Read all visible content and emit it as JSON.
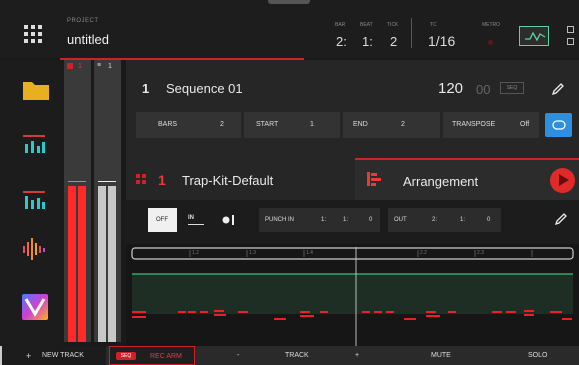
{
  "header": {
    "project_label": "PROJECT",
    "project_name": "untitled",
    "bar_label": "BAR",
    "beat_label": "BEAT",
    "tick_label": "TICK",
    "bar_value": "2:",
    "beat_value": "1:",
    "tick_value": "2",
    "tc_label": "TC",
    "tc_value": "1/16",
    "metro_label": "METRO"
  },
  "sidebar": {
    "items": [
      "folder-icon",
      "mixer-icon",
      "mixer-alt-icon",
      "sampler-icon",
      "logo-icon"
    ]
  },
  "mixer": {
    "strip1_label": "1",
    "strip2_label": "1"
  },
  "sequence": {
    "number": "1",
    "name": "Sequence 01",
    "tempo": "120",
    "tempo_decimal": "00",
    "seq_badge": "SEQ",
    "bars_label": "BARS",
    "bars_value": "2",
    "start_label": "START",
    "start_value": "1",
    "end_label": "END",
    "end_value": "2",
    "transpose_label": "TRANSPOSE",
    "transpose_value": "Off"
  },
  "kit": {
    "number": "1",
    "name": "Trap-Kit-Default",
    "arrangement_label": "Arrangement"
  },
  "transport": {
    "off_label": "OFF",
    "in_label": "IN",
    "punch_in_label": "PUNCH IN",
    "punch_in_values": [
      "1:",
      "1:",
      "0"
    ],
    "out_label": "OUT",
    "out_values": [
      "2:",
      "1:",
      "0"
    ]
  },
  "timeline": {
    "ruler_labels": [
      "1.2",
      "1.3",
      "1.4",
      "2.2",
      "2.3"
    ],
    "accent": "#d0202a",
    "green": "#3fc070"
  },
  "bottom": {
    "new_track": "NEW TRACK",
    "seq_badge": "SEQ",
    "rec_arm": "REC ARM",
    "track_minus": "-",
    "track_label": "TRACK",
    "track_plus": "+",
    "mute": "MUTE",
    "solo": "SOLO"
  }
}
